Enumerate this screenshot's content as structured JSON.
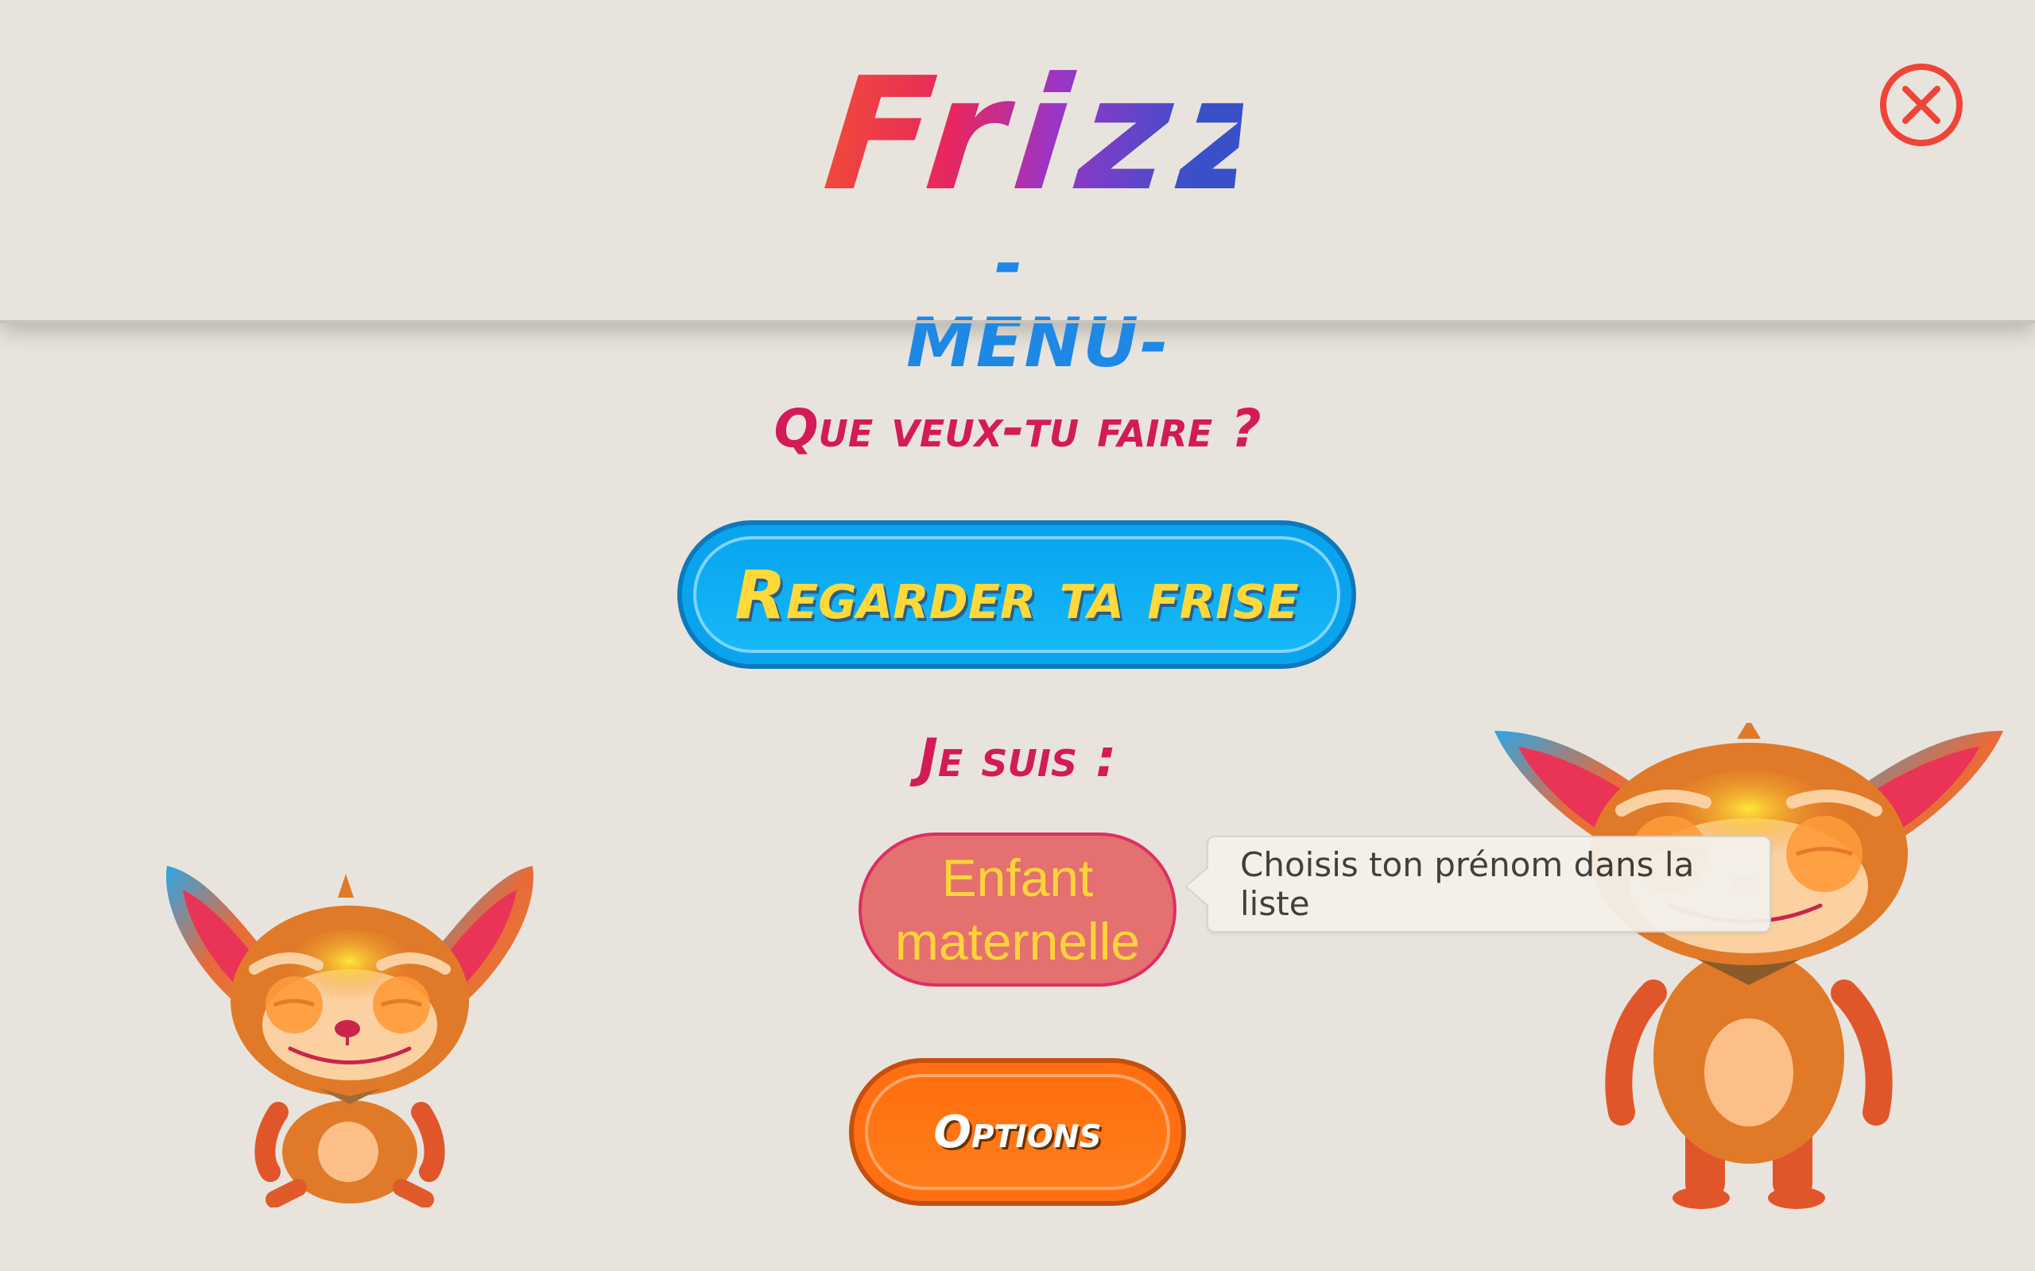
{
  "app": {
    "logo_text": "Frizz",
    "subtitle": "-MENU-"
  },
  "main": {
    "question": "Que veux-tu faire ?",
    "view_timeline_button": "Regarder ta frise",
    "i_am_label": "Je suis :",
    "child_role_button": "Enfant maternelle",
    "options_button": "Options"
  },
  "tooltip": {
    "text": "Choisis ton prénom dans la liste"
  },
  "icons": {
    "close": "close-icon",
    "mascot_left": "mascot-sitting",
    "mascot_right": "mascot-standing"
  },
  "colors": {
    "background": "#e8e4dd",
    "title_red": "#d31b57",
    "primary_blue": "#10aef5",
    "child_pink": "#e47070",
    "options_orange": "#ff7415",
    "button_text_yellow": "#ffd93a",
    "close_red": "#ef4438"
  }
}
